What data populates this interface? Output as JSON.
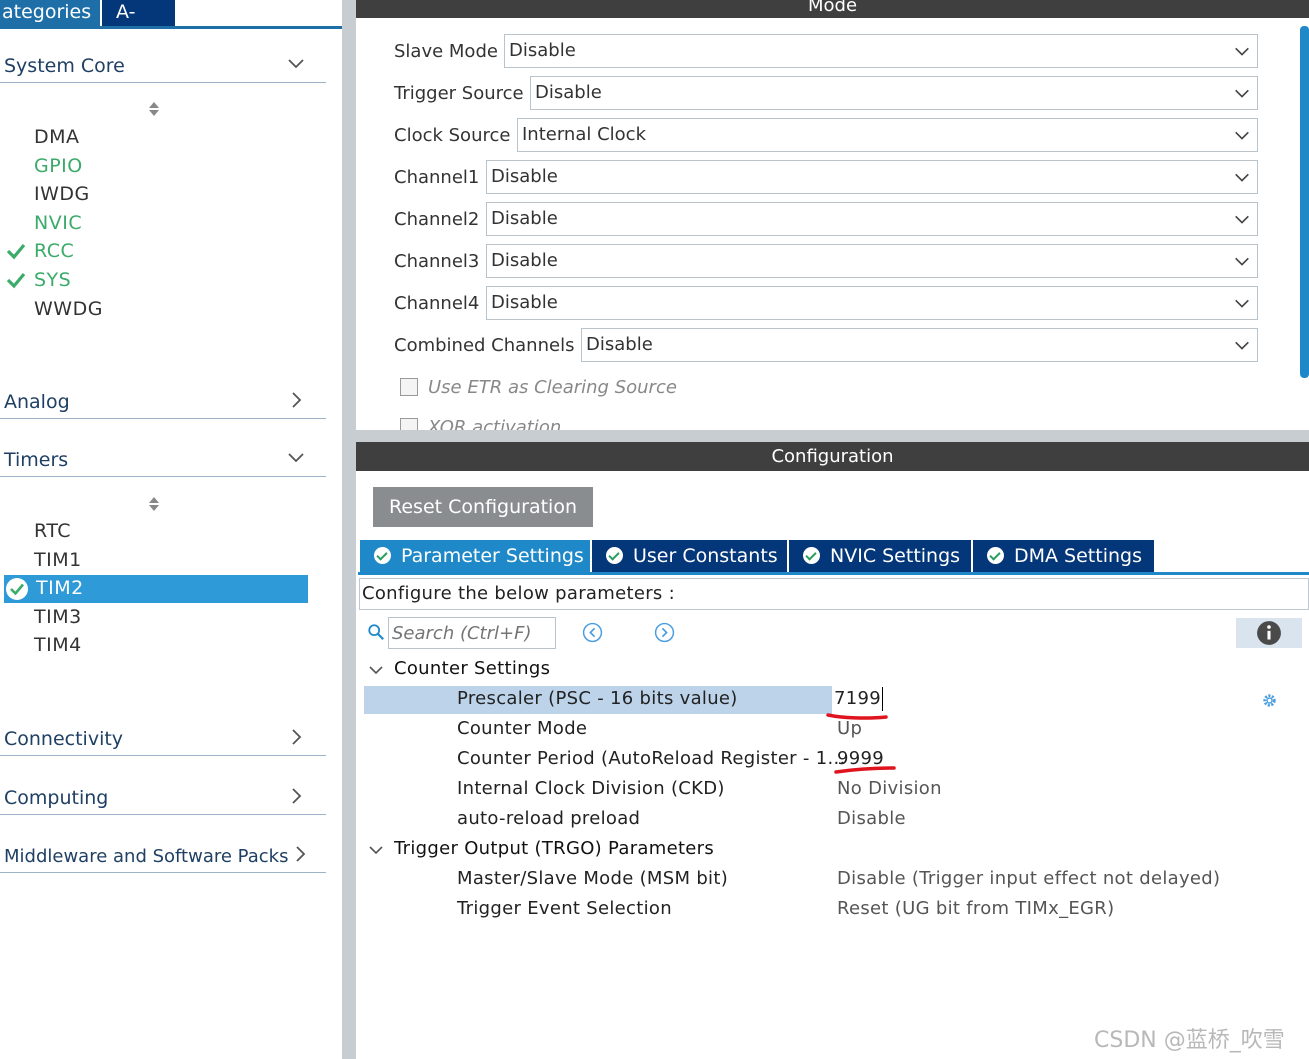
{
  "left_panel": {
    "tabs": [
      "ategories",
      "A->Z"
    ],
    "categories": {
      "system_core": "System Core",
      "analog": "Analog",
      "timers": "Timers",
      "connectivity": "Connectivity",
      "computing": "Computing",
      "middleware": "Middleware and Software Packs"
    },
    "system_core_items": [
      {
        "label": "DMA",
        "status": "none"
      },
      {
        "label": "GPIO",
        "status": "green"
      },
      {
        "label": "IWDG",
        "status": "none"
      },
      {
        "label": "NVIC",
        "status": "green"
      },
      {
        "label": "RCC",
        "status": "checked"
      },
      {
        "label": "SYS",
        "status": "checked"
      },
      {
        "label": "WWDG",
        "status": "none"
      }
    ],
    "timers_items": [
      {
        "label": "RTC",
        "status": "none"
      },
      {
        "label": "TIM1",
        "status": "none"
      },
      {
        "label": "TIM2",
        "status": "selected"
      },
      {
        "label": "TIM3",
        "status": "none"
      },
      {
        "label": "TIM4",
        "status": "none"
      }
    ]
  },
  "mode": {
    "title": "Mode",
    "fields": [
      {
        "label": "Slave Mode",
        "value": "Disable"
      },
      {
        "label": "Trigger Source",
        "value": "Disable"
      },
      {
        "label": "Clock Source",
        "value": "Internal Clock"
      },
      {
        "label": "Channel1",
        "value": "Disable"
      },
      {
        "label": "Channel2",
        "value": "Disable"
      },
      {
        "label": "Channel3",
        "value": "Disable"
      },
      {
        "label": "Channel4",
        "value": "Disable"
      },
      {
        "label": "Combined Channels",
        "value": "Disable"
      }
    ],
    "checkboxes": [
      {
        "label": "Use ETR as Clearing Source",
        "checked": false
      },
      {
        "label": "XOR activation",
        "checked": false
      }
    ]
  },
  "configuration": {
    "title": "Configuration",
    "reset_button": "Reset Configuration",
    "tabs": [
      "Parameter Settings",
      "User Constants",
      "NVIC Settings",
      "DMA Settings"
    ],
    "description": "Configure the below parameters :",
    "search_placeholder": "Search (Ctrl+F)",
    "sections": [
      {
        "title": "Counter Settings",
        "params": [
          {
            "name": "Prescaler (PSC - 16 bits value)",
            "value": "7199"
          },
          {
            "name": "Counter Mode",
            "value": "Up"
          },
          {
            "name": "Counter Period (AutoReload Register - 1...",
            "value": "9999"
          },
          {
            "name": "Internal Clock Division (CKD)",
            "value": "No Division"
          },
          {
            "name": "auto-reload preload",
            "value": "Disable"
          }
        ]
      },
      {
        "title": "Trigger Output (TRGO) Parameters",
        "params": [
          {
            "name": "Master/Slave Mode (MSM bit)",
            "value": "Disable (Trigger input effect not delayed)"
          },
          {
            "name": "Trigger Event Selection",
            "value": "Reset (UG bit from TIMx_EGR)"
          }
        ]
      }
    ]
  },
  "watermark": "CSDN @蓝桥_吹雪",
  "colors": {
    "accent": "#1e88c8",
    "header_dark": "#3f3f3f",
    "tab_dark": "#04367a",
    "annotation_red": "#e0141e",
    "green": "#3bab6a"
  }
}
